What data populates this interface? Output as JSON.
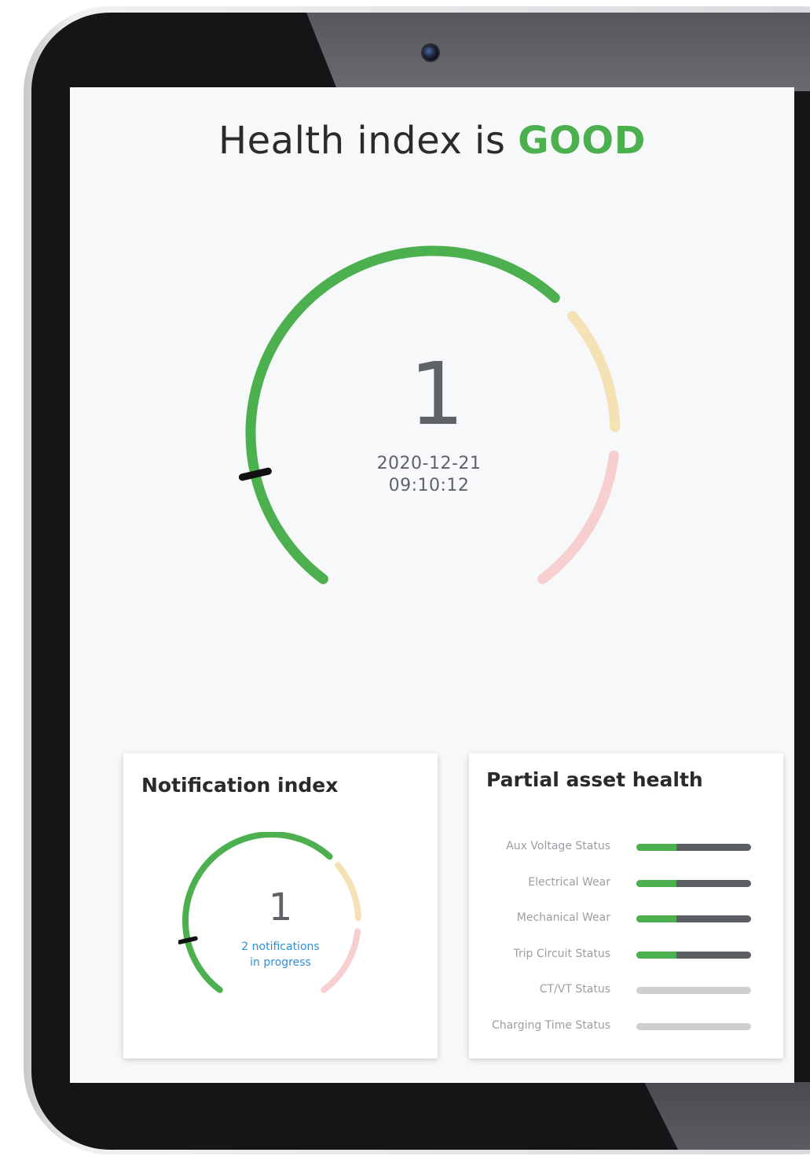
{
  "colors": {
    "good": "#4db04f",
    "warning": "#f5e2b4",
    "danger": "#f7cfcf",
    "text_muted": "#5f6368",
    "link": "#2f8fd6",
    "bar_track": "#5b5f64",
    "bar_inactive": "#cfcfcf"
  },
  "header": {
    "prefix": "Health index is",
    "status": "GOOD"
  },
  "main_gauge": {
    "value": "1",
    "date": "2020-12-21",
    "time": "09:10:12",
    "level": 0.14
  },
  "notification_card": {
    "title": "Notification index",
    "value": "1",
    "note_line_1": "2 notifications",
    "note_line_2": "in progress",
    "level": 0.14
  },
  "partial_card": {
    "title": "Partial asset health",
    "rows": [
      {
        "label": "Aux Voltage Status",
        "fill": 0.35,
        "active": true
      },
      {
        "label": "Electrical Wear",
        "fill": 0.35,
        "active": true
      },
      {
        "label": "Mechanical Wear",
        "fill": 0.35,
        "active": true
      },
      {
        "label": "Trip Circuit Status",
        "fill": 0.35,
        "active": true
      },
      {
        "label": "CT/VT Status",
        "fill": 0,
        "active": false
      },
      {
        "label": "Charging Time Status",
        "fill": 0,
        "active": false
      }
    ]
  }
}
